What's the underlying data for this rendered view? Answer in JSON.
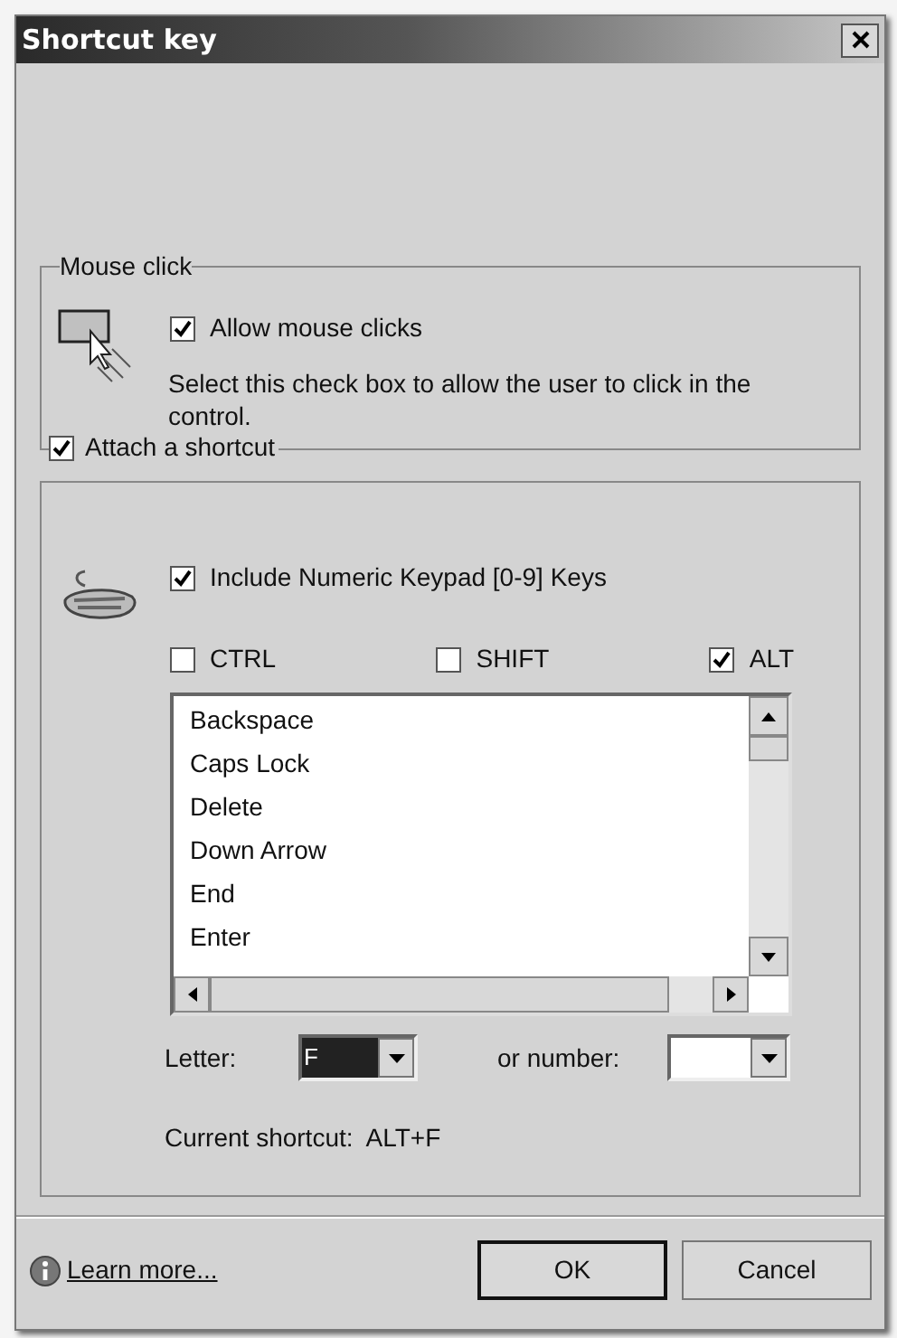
{
  "window": {
    "title": "Shortcut key"
  },
  "mouse_click": {
    "legend": "Mouse click",
    "allow": {
      "label": "Allow mouse clicks",
      "checked": true
    },
    "description": "Select this check box to allow the user to click in the control."
  },
  "attach_shortcut": {
    "label": "Attach a shortcut",
    "checked": true
  },
  "shortcut": {
    "include_keypad": {
      "label": "Include Numeric Keypad [0-9] Keys",
      "checked": true
    },
    "modifiers": [
      {
        "label": "CTRL",
        "checked": false
      },
      {
        "label": "SHIFT",
        "checked": false
      },
      {
        "label": "ALT",
        "checked": true
      }
    ],
    "keys": [
      {
        "label": "Backspace",
        "selected": false
      },
      {
        "label": "Caps Lock",
        "selected": false
      },
      {
        "label": "Delete",
        "selected": false
      },
      {
        "label": "Down Arrow",
        "selected": false
      },
      {
        "label": "End",
        "selected": false
      },
      {
        "label": "Enter",
        "selected": false
      }
    ],
    "letter": {
      "label": "Letter:",
      "value": "F"
    },
    "number": {
      "label": "or number:"
    },
    "current": "Current shortcut:  ALT+F"
  },
  "footer": {
    "learn_more": "Learn more...",
    "buttons": [
      {
        "label": "OK",
        "default": true
      },
      {
        "label": "Cancel",
        "default": false
      }
    ]
  }
}
